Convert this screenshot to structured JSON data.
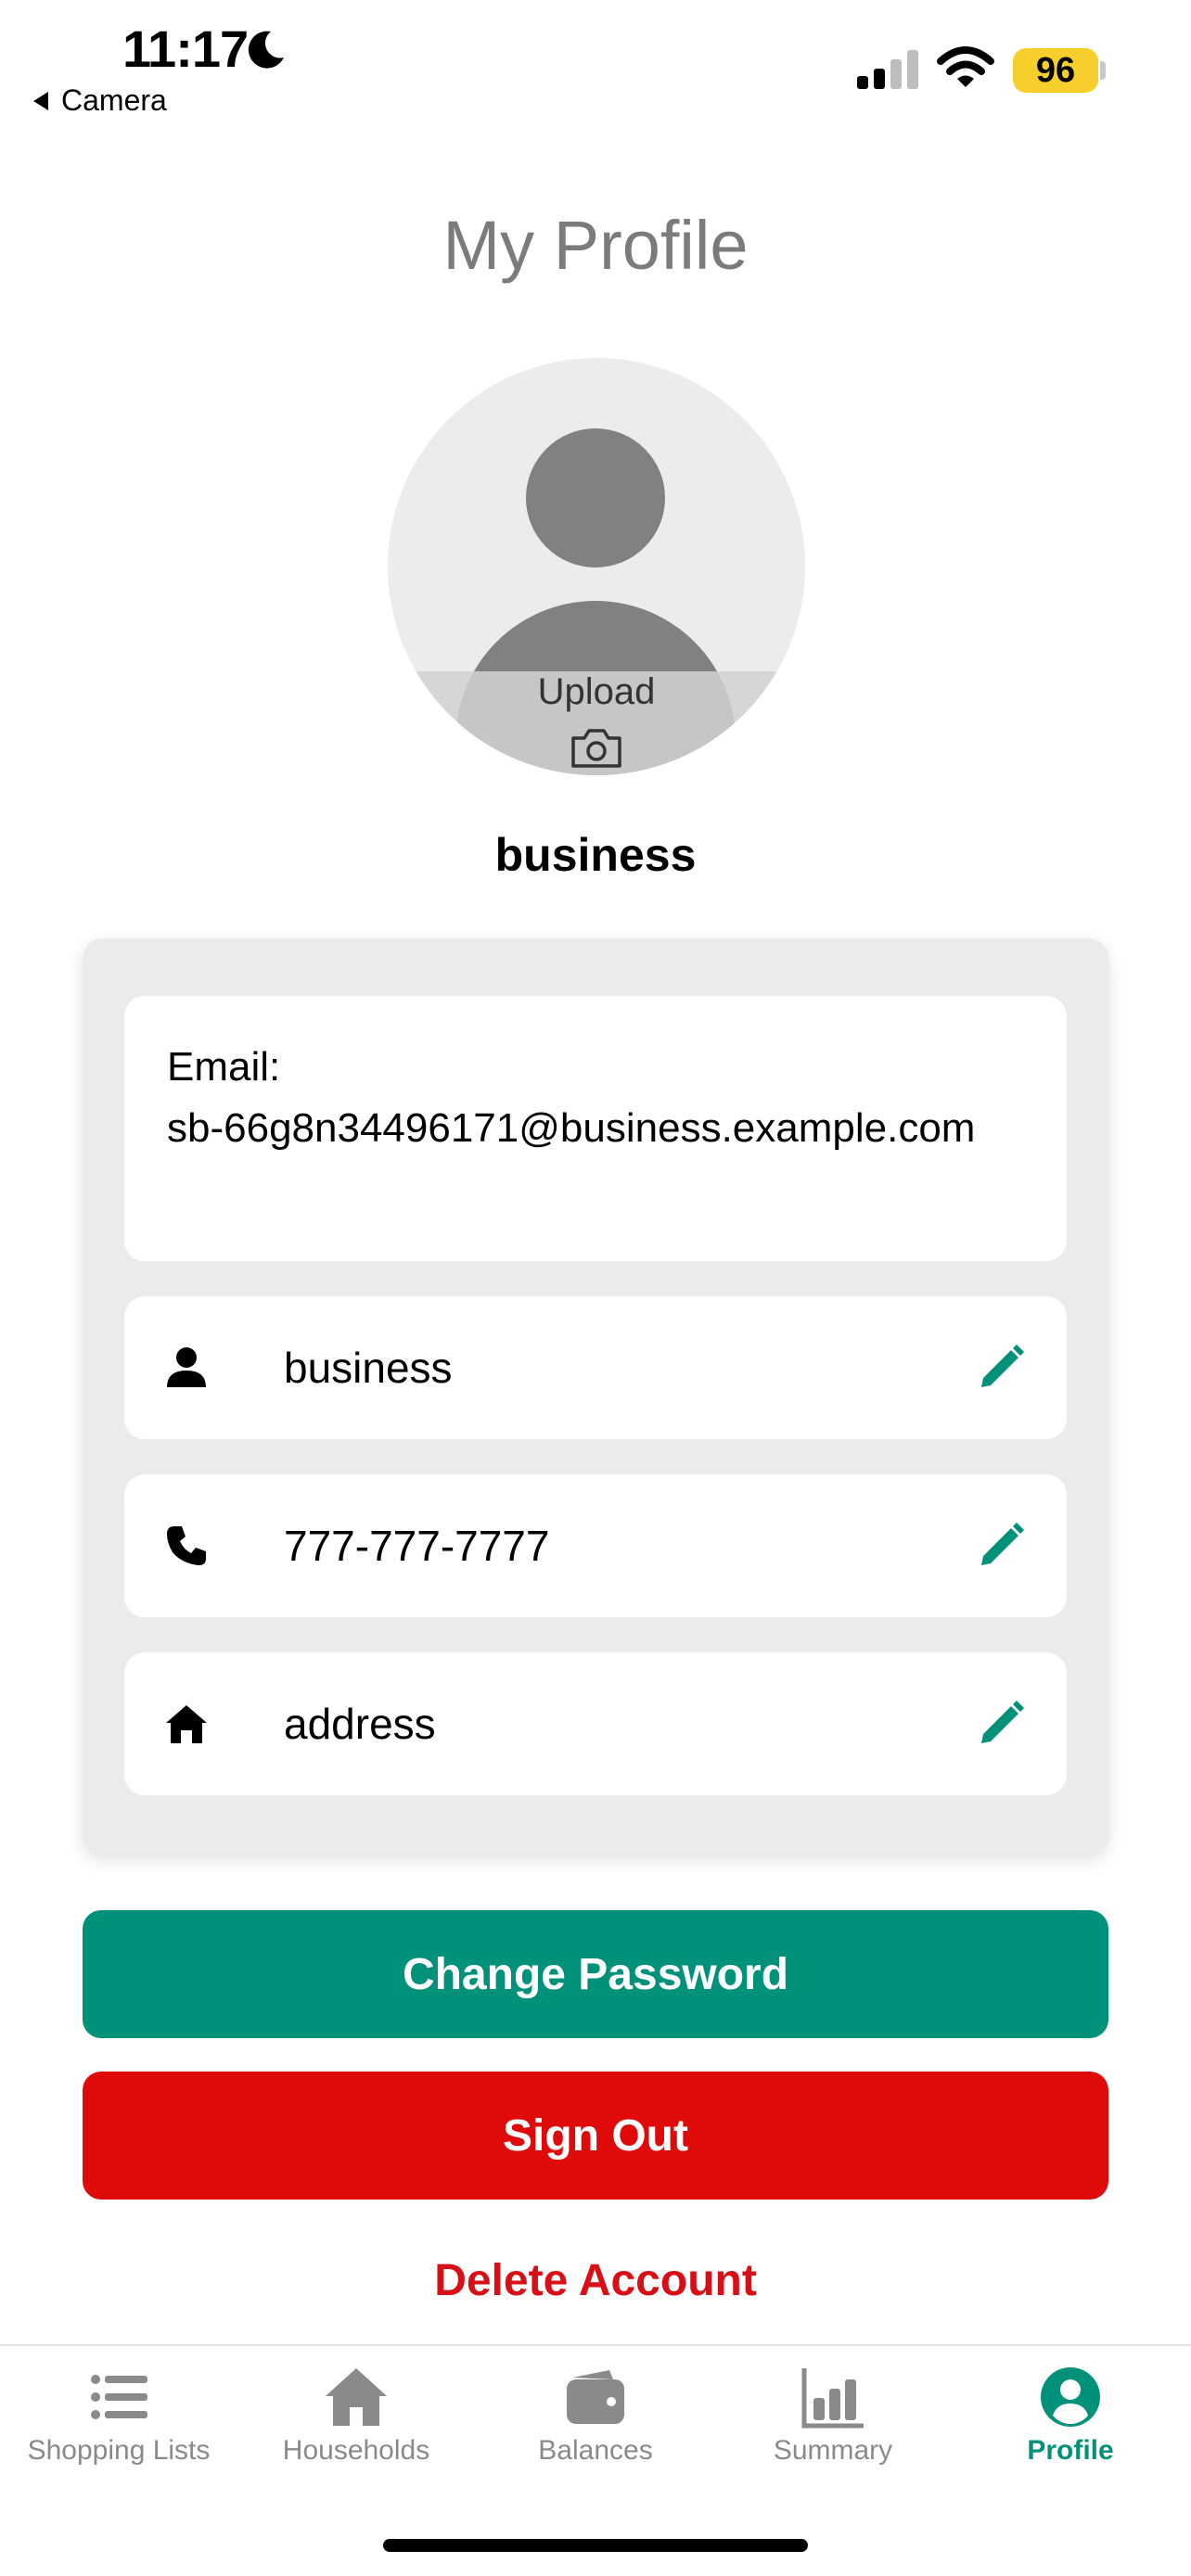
{
  "status_bar": {
    "time": "11:17",
    "back_app": "Camera",
    "battery": "96"
  },
  "page": {
    "title": "My Profile"
  },
  "avatar": {
    "upload_label": "Upload"
  },
  "profile": {
    "username": "business",
    "email_label": "Email:",
    "email_value": "sb-66g8n34496171@business.example.com",
    "name": "business",
    "phone": "777-777-7777",
    "address": "address"
  },
  "actions": {
    "change_password": "Change Password",
    "sign_out": "Sign Out",
    "delete_account": "Delete Account"
  },
  "tabs": [
    {
      "label": "Shopping Lists",
      "icon": "list-icon"
    },
    {
      "label": "Households",
      "icon": "house-icon"
    },
    {
      "label": "Balances",
      "icon": "wallet-icon"
    },
    {
      "label": "Summary",
      "icon": "bar-chart-icon"
    },
    {
      "label": "Profile",
      "icon": "profile-icon",
      "active": true
    }
  ],
  "colors": {
    "accent": "#00917a",
    "danger": "#df0b0b",
    "delete_text": "#d80f16",
    "battery": "#f7cf2d"
  }
}
